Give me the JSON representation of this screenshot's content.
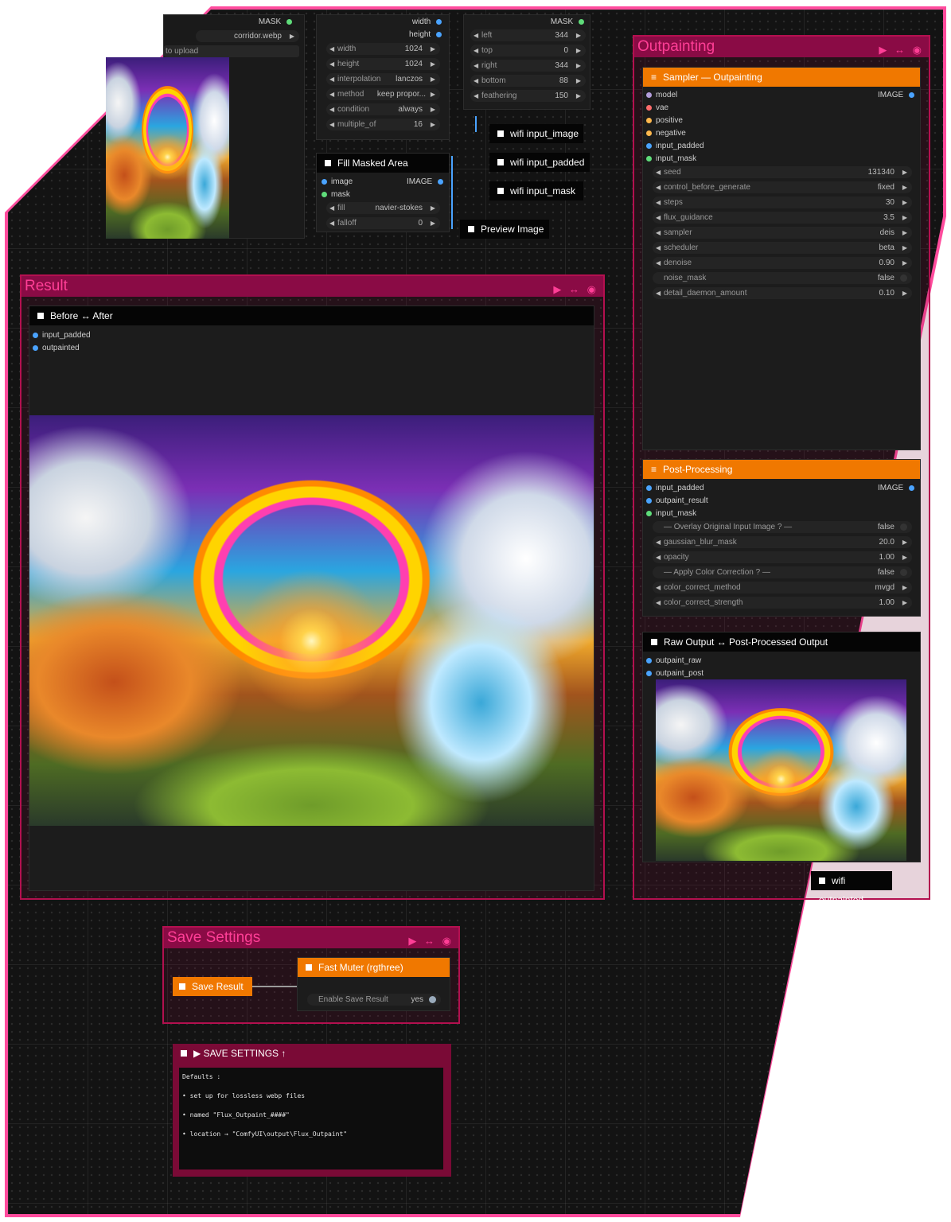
{
  "colors": {
    "accent": "#ff2d8c",
    "group_header": "#8a0b45",
    "node_header_orange": "#f07800",
    "canvas": "#131313"
  },
  "top_left_node": {
    "output_mask": "MASK",
    "image_value": "corridor.webp",
    "upload_label": "to upload"
  },
  "resize_node": {
    "outputs": [
      "width",
      "height"
    ],
    "widgets": [
      {
        "label": "width",
        "value": "1024"
      },
      {
        "label": "height",
        "value": "1024"
      },
      {
        "label": "interpolation",
        "value": "lanczos"
      },
      {
        "label": "method",
        "value": "keep propor..."
      },
      {
        "label": "condition",
        "value": "always"
      },
      {
        "label": "multiple_of",
        "value": "16"
      }
    ]
  },
  "pad_node": {
    "output_mask": "MASK",
    "widgets": [
      {
        "label": "left",
        "value": "344"
      },
      {
        "label": "top",
        "value": "0"
      },
      {
        "label": "right",
        "value": "344"
      },
      {
        "label": "bottom",
        "value": "88"
      },
      {
        "label": "feathering",
        "value": "150"
      }
    ]
  },
  "fill_masked": {
    "title": "Fill Masked Area",
    "inputs": [
      "image",
      "mask"
    ],
    "output": "IMAGE",
    "widgets": [
      {
        "label": "fill",
        "value": "navier-stokes"
      },
      {
        "label": "falloff",
        "value": "0"
      }
    ]
  },
  "wifi_nodes": [
    "wifi input_image",
    "wifi input_padded",
    "wifi input_mask"
  ],
  "preview_image": "Preview Image",
  "result_group": {
    "title": "Result",
    "compare_title": "Before ↔ After",
    "inputs": [
      "input_padded",
      "outpainted"
    ]
  },
  "outpainting_group": {
    "title": "Outpainting",
    "sampler": {
      "title": "Sampler — Outpainting",
      "inputs": [
        "model",
        "vae",
        "positive",
        "negative",
        "input_padded",
        "input_mask"
      ],
      "output": "IMAGE",
      "widgets": [
        {
          "label": "seed",
          "value": "131340"
        },
        {
          "label": "control_before_generate",
          "value": "fixed"
        },
        {
          "label": "steps",
          "value": "30"
        },
        {
          "label": "flux_guidance",
          "value": "3.5"
        },
        {
          "label": "sampler",
          "value": "deis"
        },
        {
          "label": "scheduler",
          "value": "beta"
        },
        {
          "label": "denoise",
          "value": "0.90"
        },
        {
          "label": "noise_mask",
          "value": "false"
        },
        {
          "label": "detail_daemon_amount",
          "value": "0.10"
        }
      ]
    },
    "post": {
      "title": "Post-Processing",
      "inputs": [
        "input_padded",
        "outpaint_result",
        "input_mask"
      ],
      "output": "IMAGE",
      "widgets": [
        {
          "label": "— Overlay Original Input Image ? —",
          "value": "false"
        },
        {
          "label": "gaussian_blur_mask",
          "value": "20.0"
        },
        {
          "label": "opacity",
          "value": "1.00"
        },
        {
          "label": "— Apply Color Correction ? —",
          "value": "false"
        },
        {
          "label": "color_correct_method",
          "value": "mvgd"
        },
        {
          "label": "color_correct_strength",
          "value": "1.00"
        }
      ]
    },
    "raw_compare": {
      "title": "Raw Output ↔ Post-Processed Output",
      "inputs": [
        "outpaint_raw",
        "outpaint_post"
      ]
    },
    "wifi_out": "wifi outpainted"
  },
  "save_group": {
    "title": "Save Settings",
    "save_result": "Save Result",
    "fast_muter": "Fast Muter (rgthree)",
    "enable_label": "Enable Save Result",
    "enable_value": "yes"
  },
  "notes": {
    "title": "▶ SAVE SETTINGS ↑",
    "lines": [
      "Defaults :",
      "• set up for lossless webp files",
      "• named \"Flux_Outpaint_####\"",
      "• location → \"ComfyUI\\output\\Flux_Outpaint\""
    ]
  }
}
